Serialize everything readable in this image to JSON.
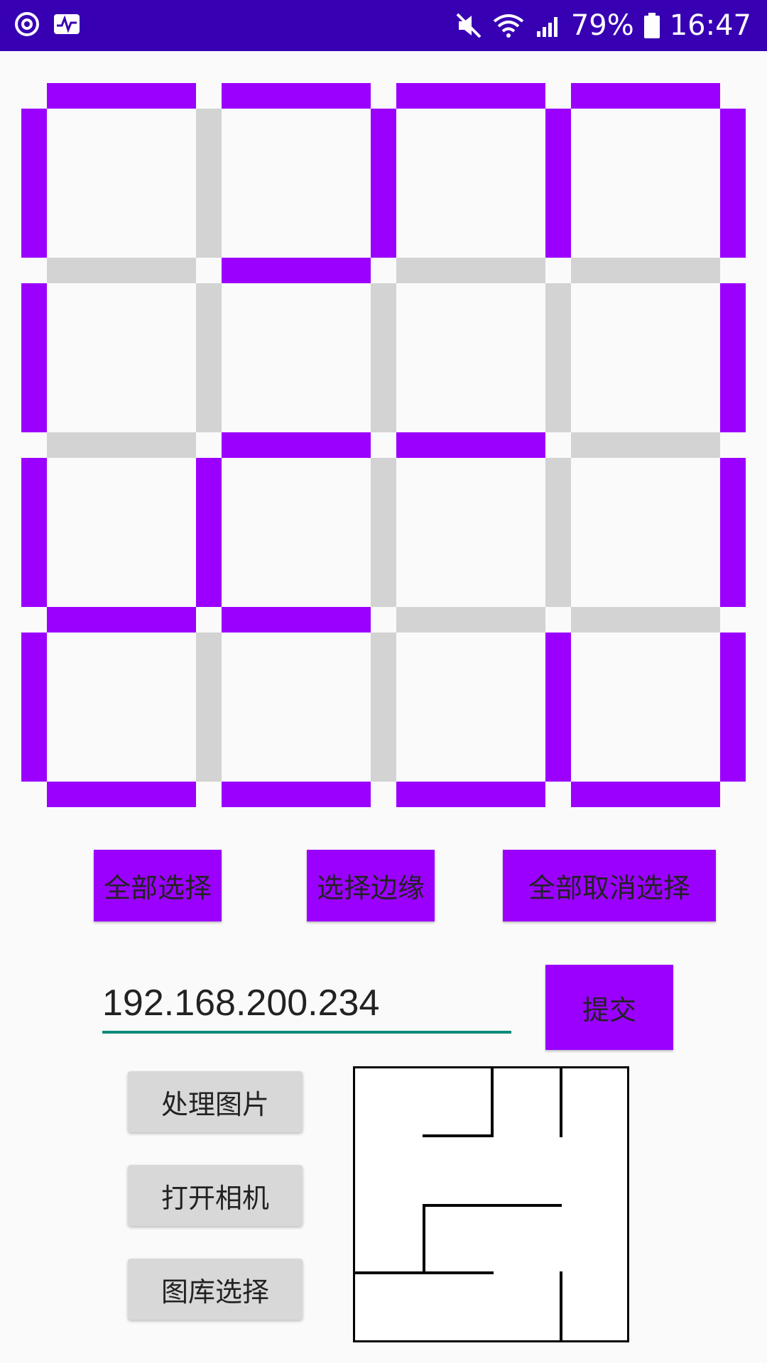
{
  "status_bar": {
    "battery": "79%",
    "time": "16:47",
    "icons": [
      "sync-icon",
      "activity-monitor-icon",
      "mute-icon",
      "wifi-icon",
      "signal-icon",
      "battery-icon"
    ]
  },
  "grid": {
    "rows": 4,
    "cols": 4,
    "selected_color": "#9b00ff",
    "unselected_color": "#d3d3d3",
    "horizontal_selected": [
      [
        true,
        true,
        true,
        true
      ],
      [
        false,
        true,
        false,
        false
      ],
      [
        false,
        true,
        true,
        false
      ],
      [
        true,
        true,
        false,
        false
      ],
      [
        true,
        true,
        true,
        true
      ]
    ],
    "vertical_selected": [
      [
        true,
        false,
        true,
        true,
        true
      ],
      [
        true,
        false,
        false,
        false,
        true
      ],
      [
        true,
        true,
        false,
        false,
        true
      ],
      [
        true,
        false,
        false,
        true,
        true
      ]
    ]
  },
  "buttons": {
    "select_all": "全部选择",
    "select_edges": "选择边缘",
    "deselect_all": "全部取消选择",
    "submit": "提交",
    "process_image": "处理图片",
    "open_camera": "打开相机",
    "gallery_select": "图库选择"
  },
  "ip_field": {
    "value": "192.168.200.234"
  },
  "colors": {
    "status_bar": "#3700b3",
    "accent_purple": "#9b00ff",
    "input_underline": "#0e8a7a"
  }
}
